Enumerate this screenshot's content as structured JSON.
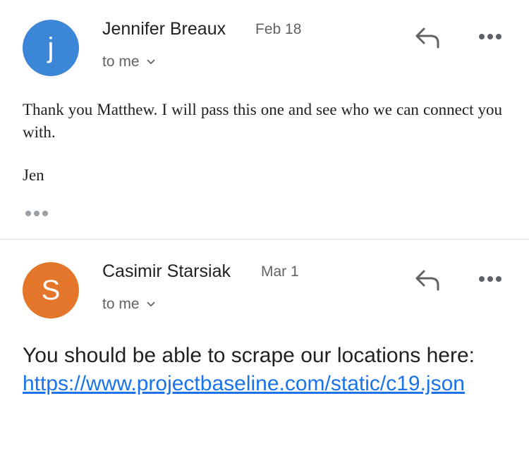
{
  "messages": [
    {
      "avatar_initial": "j",
      "avatar_color": "#3b86d6",
      "sender": "Jennifer Breaux",
      "date": "Feb 18",
      "recipient": "to me",
      "body": "Thank you Matthew. I will pass this one and see who we can connect you with.",
      "signature": "Jen"
    },
    {
      "avatar_initial": "S",
      "avatar_color": "#e3762a",
      "sender": "Casimir Starsiak",
      "date": "Mar 1",
      "recipient": "to me",
      "body_prefix": "You should be able to scrape our locations here:",
      "link": "https://www.projectbaseline.com/static/c19.json"
    }
  ],
  "icons": {
    "reply": "reply-arrow-icon",
    "more": "more-horizontal-icon",
    "chevron": "chevron-down-icon",
    "trimmed": "show-trimmed-content-icon"
  },
  "colors": {
    "secondary_text": "#5f6368",
    "link": "#1a73e8",
    "divider": "#dadce0"
  }
}
